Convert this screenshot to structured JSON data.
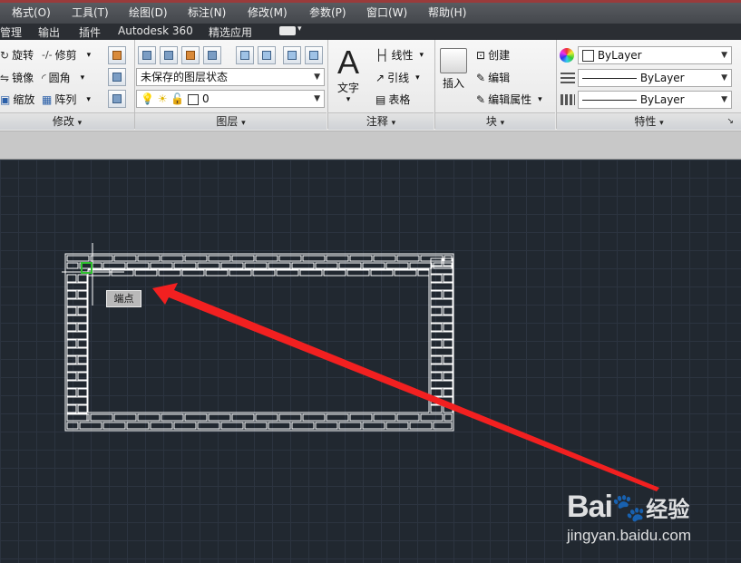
{
  "menu": {
    "items": [
      "格式(O)",
      "工具(T)",
      "绘图(D)",
      "标注(N)",
      "修改(M)",
      "参数(P)",
      "窗口(W)",
      "帮助(H)"
    ]
  },
  "ribbon_tabs": [
    "管理",
    "输出",
    "插件",
    "Autodesk 360",
    "精选应用"
  ],
  "modify_panel": {
    "title": "修改",
    "rotate": "旋转",
    "mirror": "镜像",
    "scale": "缩放",
    "trim": "修剪",
    "fillet": "圆角",
    "array": "阵列"
  },
  "layer_panel": {
    "title": "图层",
    "layer_state": "未保存的图层状态",
    "current_layer": "0"
  },
  "annotation_panel": {
    "title": "注释",
    "text": "文字",
    "linear": "线性",
    "leader": "引线",
    "table": "表格"
  },
  "block_panel": {
    "title": "块",
    "insert": "插入",
    "create": "创建",
    "edit": "编辑",
    "edit_attributes": "编辑属性"
  },
  "properties_panel": {
    "title": "特性",
    "color": "ByLayer",
    "linetype": "ByLayer",
    "lineweight": "ByLayer"
  },
  "canvas": {
    "snap_tooltip": "端点"
  },
  "watermark": {
    "brand": "Bai",
    "brand_tail": "经验",
    "url": "jingyan.baidu.com"
  },
  "colors": {
    "canvas_bg": "#212830",
    "arrow": "#f22020",
    "snap_marker": "#2fbf2f",
    "drawing_lines": "#ffffff"
  }
}
